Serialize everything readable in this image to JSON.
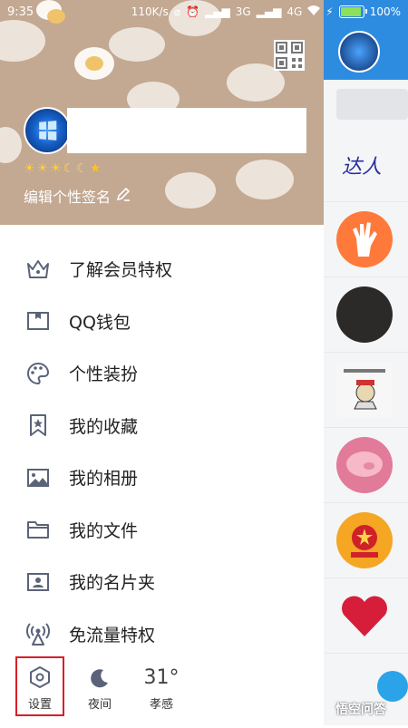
{
  "status_bar": {
    "time": "9:35",
    "network_speed": "110K/s",
    "signal_3g": "3G",
    "signal_4g": "4G",
    "battery": "100%"
  },
  "drawer": {
    "signature_label": "编辑个性签名",
    "level_icons": [
      "☀",
      "☀",
      "☀",
      "☾",
      "☾",
      "★"
    ],
    "menu": [
      {
        "label": "了解会员特权",
        "icon": "crown-icon"
      },
      {
        "label": "QQ钱包",
        "icon": "wallet-icon"
      },
      {
        "label": "个性装扮",
        "icon": "palette-icon"
      },
      {
        "label": "我的收藏",
        "icon": "bookmark-star-icon"
      },
      {
        "label": "我的相册",
        "icon": "photo-icon"
      },
      {
        "label": "我的文件",
        "icon": "folder-icon"
      },
      {
        "label": "我的名片夹",
        "icon": "contact-card-icon"
      },
      {
        "label": "免流量特权",
        "icon": "antenna-icon"
      }
    ],
    "bottom": {
      "settings_label": "设置",
      "night_label": "夜间",
      "weather_temp": "31°",
      "weather_location": "孝感"
    }
  },
  "background_panel": {
    "daren_label": "达人"
  },
  "watermark": "悟空问答",
  "colors": {
    "header_bg": "#c3a892",
    "icon_gray": "#5a6378",
    "highlight_border": "#d81f26",
    "qq_blue": "#2d8cdf"
  }
}
